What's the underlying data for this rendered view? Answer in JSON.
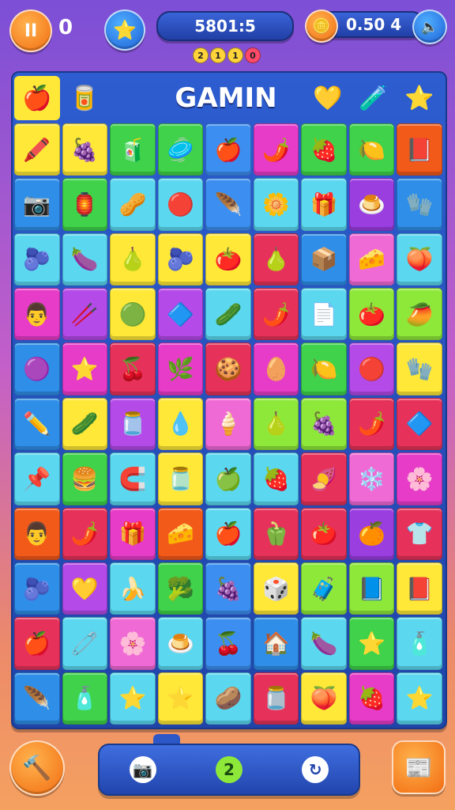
{
  "top": {
    "pause_label": "II",
    "left_counter": "0",
    "score": "5801:5",
    "timer": "0.50 4",
    "dots": [
      "2",
      "1",
      "1",
      "0"
    ]
  },
  "board": {
    "title": "GAMIN",
    "header_icons": [
      "🍎",
      "🥫",
      "💛",
      "🧪",
      "⭐"
    ]
  },
  "grid": [
    [
      "🖍️",
      "🍇",
      "🧃",
      "🥏",
      "🍎",
      "🌶️",
      "🍓",
      "🍋",
      "📕"
    ],
    [
      "📷",
      "🏮",
      "🥜",
      "🔴",
      "🪶",
      "🌼",
      "🎁",
      "🍮",
      "🧤"
    ],
    [
      "🫐",
      "🍆",
      "🍐",
      "🫐",
      "🍅",
      "🍐",
      "📦",
      "🧀",
      "🍑"
    ],
    [
      "👨",
      "🥢",
      "🟢",
      "🔷",
      "🥒",
      "🌶️",
      "📄",
      "🍅",
      "🥭"
    ],
    [
      "🟣",
      "⭐",
      "🍒",
      "🌿",
      "🍪",
      "🥚",
      "🍋",
      "🔴",
      "🧤"
    ],
    [
      "✏️",
      "🥒",
      "🫙",
      "💧",
      "🍦",
      "🍐",
      "🍇",
      "🌶️",
      "🔷"
    ],
    [
      "📌",
      "🍔",
      "🧲",
      "🫙",
      "🍏",
      "🍓",
      "🍠",
      "❄️",
      "🌸"
    ],
    [
      "👨",
      "🌶️",
      "🎁",
      "🧀",
      "🍎",
      "🫑",
      "🍅",
      "🍊",
      "👕"
    ],
    [
      "🫐",
      "💛",
      "🍌",
      "🥦",
      "🍇",
      "🎲",
      "🧳",
      "📘",
      "📕"
    ],
    [
      "🍎",
      "🧷",
      "🌸",
      "🍮",
      "🍒",
      "🏠",
      "🍆",
      "⭐",
      "🧴"
    ],
    [
      "🪶",
      "🧴",
      "⭐",
      "⭐",
      "🥔",
      "🫙",
      "🍑",
      "🍓",
      "⭐"
    ]
  ],
  "grid_colors": [
    [
      "#ffe838",
      "#ffe838",
      "#3fd24a",
      "#3fd24a",
      "#3c8ef0",
      "#e63cc8",
      "#3fd24a",
      "#3fd24a",
      "#f25a1a"
    ],
    [
      "#2f8ee8",
      "#3fd24a",
      "#5bd8f0",
      "#5bd8f0",
      "#3c8ef0",
      "#5bd8f0",
      "#5bd8f0",
      "#9a3ee0",
      "#2f8ee8"
    ],
    [
      "#5bd8f0",
      "#5bd8f0",
      "#ffe838",
      "#ffe838",
      "#ffe838",
      "#e6325a",
      "#2f8ee8",
      "#f06ad6",
      "#5bd8f0"
    ],
    [
      "#e63cc8",
      "#b44ae8",
      "#ffe838",
      "#b44ae8",
      "#5bd8f0",
      "#e6325a",
      "#5bd8f0",
      "#8ee83a",
      "#8ee83a"
    ],
    [
      "#2f8ee8",
      "#e63cc8",
      "#e6325a",
      "#e63cc8",
      "#e6325a",
      "#e63cc8",
      "#3fd24a",
      "#b44ae8",
      "#ffe838"
    ],
    [
      "#2f8ee8",
      "#ffe838",
      "#b44ae8",
      "#ffe838",
      "#f06ad6",
      "#8ee83a",
      "#8ee83a",
      "#e6325a",
      "#e6325a"
    ],
    [
      "#5bd8f0",
      "#3fd24a",
      "#5bd8f0",
      "#ffe838",
      "#5bd8f0",
      "#5bd8f0",
      "#e6325a",
      "#f06ad6",
      "#e63cc8"
    ],
    [
      "#f25a1a",
      "#e6325a",
      "#e63cc8",
      "#f25a1a",
      "#5bd8f0",
      "#e6325a",
      "#e6325a",
      "#9a3ee0",
      "#e6325a"
    ],
    [
      "#2f8ee8",
      "#b44ae8",
      "#5bd8f0",
      "#3fd24a",
      "#3c8ef0",
      "#ffe838",
      "#8ee83a",
      "#8ee83a",
      "#ffe838"
    ],
    [
      "#e6325a",
      "#5bd8f0",
      "#f06ad6",
      "#5bd8f0",
      "#3c8ef0",
      "#2f8ee8",
      "#5bd8f0",
      "#3fd24a",
      "#5bd8f0"
    ],
    [
      "#2f8ee8",
      "#3fd24a",
      "#5bd8f0",
      "#ffe838",
      "#5bd8f0",
      "#e6325a",
      "#ffe838",
      "#e63cc8",
      "#5bd8f0"
    ]
  ],
  "bottom": {
    "left_icon": "🔨",
    "right_icon": "📰",
    "bar_icons": [
      "📷",
      "2",
      "↻"
    ]
  }
}
